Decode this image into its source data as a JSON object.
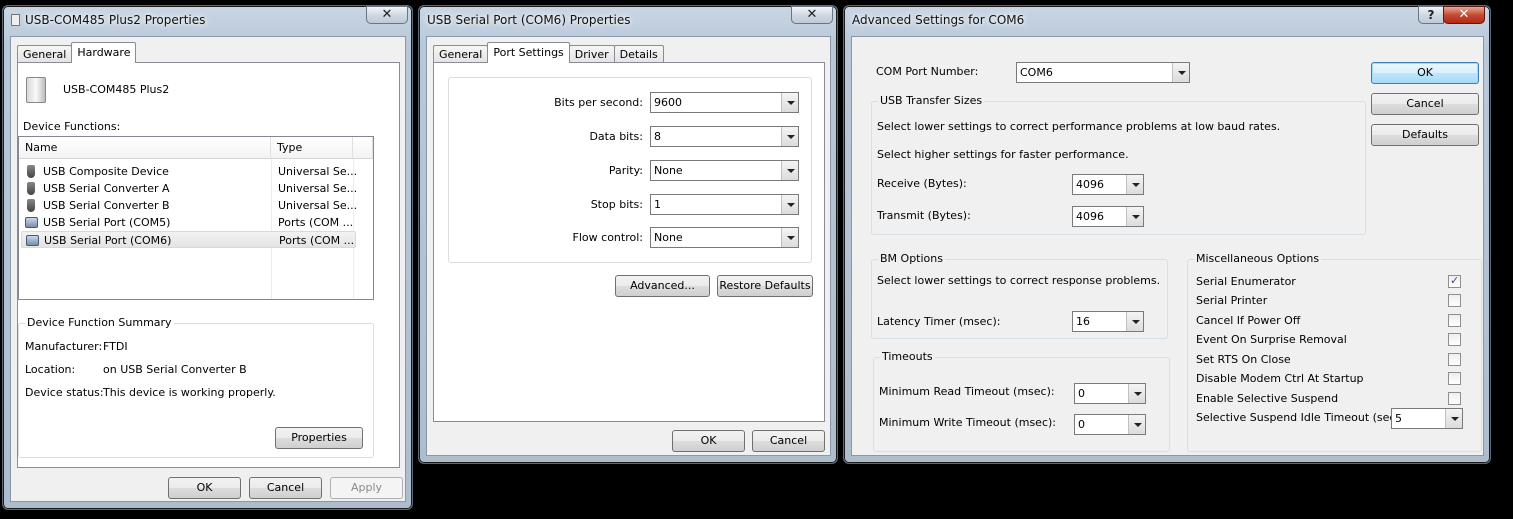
{
  "dialog1": {
    "title": "USB-COM485 Plus2 Properties",
    "close_label": "✕",
    "tabs": [
      {
        "label": "General"
      },
      {
        "label": "Hardware"
      }
    ],
    "device_name": "USB-COM485 Plus2",
    "functions_label": "Device Functions:",
    "columns": [
      "Name",
      "Type"
    ],
    "rows": [
      {
        "name": "USB Composite Device",
        "type": "Universal Se...",
        "icon": "usb-plug-icon"
      },
      {
        "name": "USB Serial Converter A",
        "type": "Universal Se...",
        "icon": "usb-plug-icon"
      },
      {
        "name": "USB Serial Converter B",
        "type": "Universal Se...",
        "icon": "usb-plug-icon"
      },
      {
        "name": "USB Serial Port (COM5)",
        "type": "Ports (COM ...",
        "icon": "serial-port-icon"
      },
      {
        "name": "USB Serial Port (COM6)",
        "type": "Ports (COM ...",
        "icon": "serial-port-icon"
      }
    ],
    "summary_title": "Device Function Summary",
    "manufacturer_label": "Manufacturer:",
    "manufacturer_value": "FTDI",
    "location_label": "Location:",
    "location_value": "on USB Serial Converter B",
    "status_label": "Device status:",
    "status_value": "This device is working properly.",
    "properties_button": "Properties",
    "ok": "OK",
    "cancel": "Cancel",
    "apply": "Apply"
  },
  "dialog2": {
    "title": "USB Serial Port (COM6) Properties",
    "close_label": "✕",
    "tabs": [
      {
        "label": "General"
      },
      {
        "label": "Port Settings"
      },
      {
        "label": "Driver"
      },
      {
        "label": "Details"
      }
    ],
    "fields": [
      {
        "label": "Bits per second:",
        "value": "9600"
      },
      {
        "label": "Data bits:",
        "value": "8"
      },
      {
        "label": "Parity:",
        "value": "None"
      },
      {
        "label": "Stop bits:",
        "value": "1"
      },
      {
        "label": "Flow control:",
        "value": "None"
      }
    ],
    "advanced_button": "Advanced...",
    "restore_button": "Restore Defaults",
    "ok": "OK",
    "cancel": "Cancel"
  },
  "dialog3": {
    "title": "Advanced Settings for COM6",
    "help_label": "?",
    "close_label": "✕",
    "com_port_label": "COM Port Number:",
    "com_port_value": "COM6",
    "ok": "OK",
    "cancel": "Cancel",
    "defaults": "Defaults",
    "usb_group": "USB Transfer Sizes",
    "usb_text1": "Select lower settings to correct performance problems at low baud rates.",
    "usb_text2": "Select higher settings for faster performance.",
    "receive_label": "Receive (Bytes):",
    "receive_value": "4096",
    "transmit_label": "Transmit (Bytes):",
    "transmit_value": "4096",
    "bm_group": "BM Options",
    "bm_text": "Select lower settings to correct response problems.",
    "latency_label": "Latency Timer (msec):",
    "latency_value": "16",
    "timeouts_group": "Timeouts",
    "read_timeout_label": "Minimum Read Timeout (msec):",
    "read_timeout_value": "0",
    "write_timeout_label": "Minimum Write Timeout (msec):",
    "write_timeout_value": "0",
    "misc_group": "Miscellaneous Options",
    "misc_options": [
      {
        "label": "Serial Enumerator",
        "checked": true
      },
      {
        "label": "Serial Printer",
        "checked": false
      },
      {
        "label": "Cancel If Power Off",
        "checked": false
      },
      {
        "label": "Event On Surprise Removal",
        "checked": false
      },
      {
        "label": "Set RTS On Close",
        "checked": false
      },
      {
        "label": "Disable Modem Ctrl At Startup",
        "checked": false
      },
      {
        "label": "Enable Selective Suspend",
        "checked": false
      }
    ],
    "suspend_label": "Selective Suspend Idle Timeout (secs):",
    "suspend_value": "5"
  }
}
